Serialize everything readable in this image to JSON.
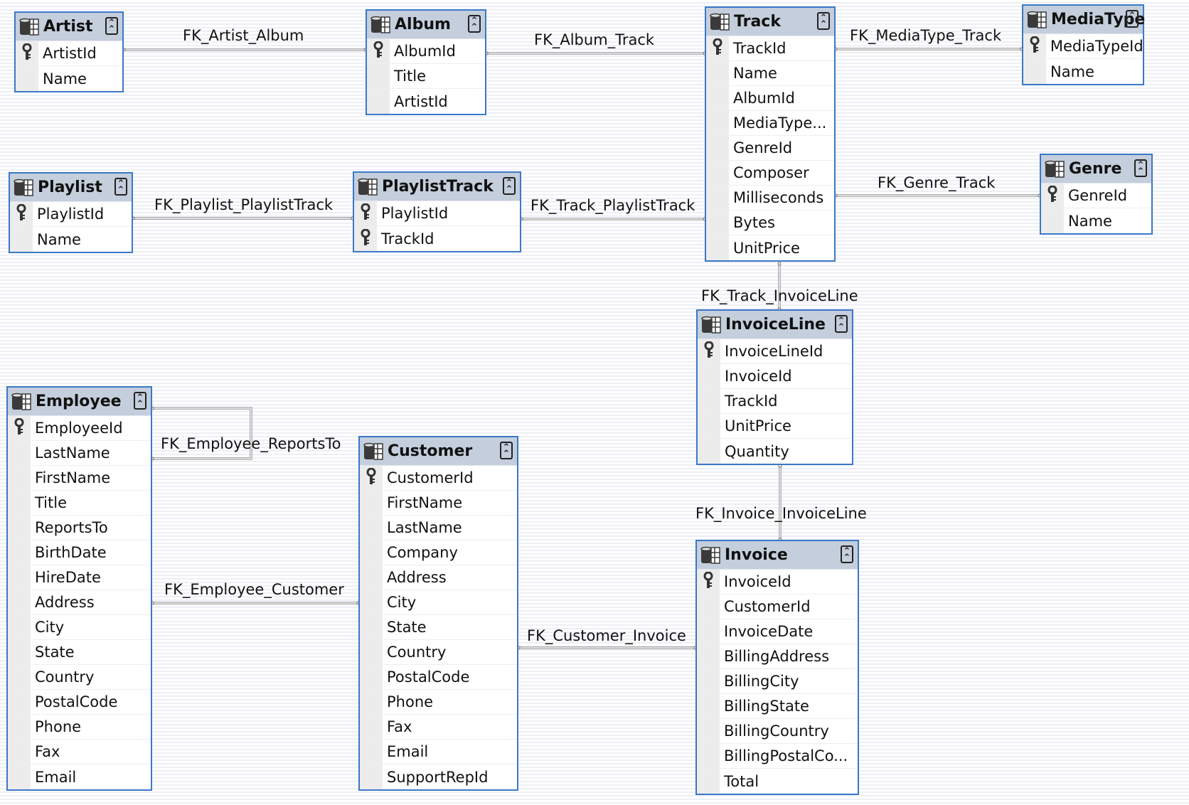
{
  "tables": {
    "artist": {
      "name": "Artist",
      "columns": [
        {
          "name": "ArtistId",
          "pk": true
        },
        {
          "name": "Name",
          "pk": false
        }
      ]
    },
    "album": {
      "name": "Album",
      "columns": [
        {
          "name": "AlbumId",
          "pk": true
        },
        {
          "name": "Title",
          "pk": false
        },
        {
          "name": "ArtistId",
          "pk": false
        }
      ]
    },
    "track": {
      "name": "Track",
      "columns": [
        {
          "name": "TrackId",
          "pk": true
        },
        {
          "name": "Name",
          "pk": false
        },
        {
          "name": "AlbumId",
          "pk": false
        },
        {
          "name": "MediaType...",
          "pk": false
        },
        {
          "name": "GenreId",
          "pk": false
        },
        {
          "name": "Composer",
          "pk": false
        },
        {
          "name": "Milliseconds",
          "pk": false
        },
        {
          "name": "Bytes",
          "pk": false
        },
        {
          "name": "UnitPrice",
          "pk": false
        }
      ]
    },
    "mediatype": {
      "name": "MediaType",
      "columns": [
        {
          "name": "MediaTypeId",
          "pk": true
        },
        {
          "name": "Name",
          "pk": false
        }
      ]
    },
    "genre": {
      "name": "Genre",
      "columns": [
        {
          "name": "GenreId",
          "pk": true
        },
        {
          "name": "Name",
          "pk": false
        }
      ]
    },
    "playlist": {
      "name": "Playlist",
      "columns": [
        {
          "name": "PlaylistId",
          "pk": true
        },
        {
          "name": "Name",
          "pk": false
        }
      ]
    },
    "playlisttrack": {
      "name": "PlaylistTrack",
      "columns": [
        {
          "name": "PlaylistId",
          "pk": true
        },
        {
          "name": "TrackId",
          "pk": true
        }
      ]
    },
    "invoiceline": {
      "name": "InvoiceLine",
      "columns": [
        {
          "name": "InvoiceLineId",
          "pk": true
        },
        {
          "name": "InvoiceId",
          "pk": false
        },
        {
          "name": "TrackId",
          "pk": false
        },
        {
          "name": "UnitPrice",
          "pk": false
        },
        {
          "name": "Quantity",
          "pk": false
        }
      ]
    },
    "employee": {
      "name": "Employee",
      "columns": [
        {
          "name": "EmployeeId",
          "pk": true
        },
        {
          "name": "LastName",
          "pk": false
        },
        {
          "name": "FirstName",
          "pk": false
        },
        {
          "name": "Title",
          "pk": false
        },
        {
          "name": "ReportsTo",
          "pk": false
        },
        {
          "name": "BirthDate",
          "pk": false
        },
        {
          "name": "HireDate",
          "pk": false
        },
        {
          "name": "Address",
          "pk": false
        },
        {
          "name": "City",
          "pk": false
        },
        {
          "name": "State",
          "pk": false
        },
        {
          "name": "Country",
          "pk": false
        },
        {
          "name": "PostalCode",
          "pk": false
        },
        {
          "name": "Phone",
          "pk": false
        },
        {
          "name": "Fax",
          "pk": false
        },
        {
          "name": "Email",
          "pk": false
        }
      ]
    },
    "customer": {
      "name": "Customer",
      "columns": [
        {
          "name": "CustomerId",
          "pk": true
        },
        {
          "name": "FirstName",
          "pk": false
        },
        {
          "name": "LastName",
          "pk": false
        },
        {
          "name": "Company",
          "pk": false
        },
        {
          "name": "Address",
          "pk": false
        },
        {
          "name": "City",
          "pk": false
        },
        {
          "name": "State",
          "pk": false
        },
        {
          "name": "Country",
          "pk": false
        },
        {
          "name": "PostalCode",
          "pk": false
        },
        {
          "name": "Phone",
          "pk": false
        },
        {
          "name": "Fax",
          "pk": false
        },
        {
          "name": "Email",
          "pk": false
        },
        {
          "name": "SupportRepId",
          "pk": false
        }
      ]
    },
    "invoice": {
      "name": "Invoice",
      "columns": [
        {
          "name": "InvoiceId",
          "pk": true
        },
        {
          "name": "CustomerId",
          "pk": false
        },
        {
          "name": "InvoiceDate",
          "pk": false
        },
        {
          "name": "BillingAddress",
          "pk": false
        },
        {
          "name": "BillingCity",
          "pk": false
        },
        {
          "name": "BillingState",
          "pk": false
        },
        {
          "name": "BillingCountry",
          "pk": false
        },
        {
          "name": "BillingPostalCo...",
          "pk": false
        },
        {
          "name": "Total",
          "pk": false
        }
      ]
    }
  },
  "relationships": [
    {
      "id": "artist_album",
      "label": "FK_Artist_Album",
      "from": "Album",
      "to": "Artist"
    },
    {
      "id": "album_track",
      "label": "FK_Album_Track",
      "from": "Track",
      "to": "Album"
    },
    {
      "id": "mediatype_track",
      "label": "FK_MediaType_Track",
      "from": "Track",
      "to": "MediaType"
    },
    {
      "id": "genre_track",
      "label": "FK_Genre_Track",
      "from": "Track",
      "to": "Genre"
    },
    {
      "id": "playlist_playlisttrack",
      "label": "FK_Playlist_PlaylistTrack",
      "from": "PlaylistTrack",
      "to": "Playlist"
    },
    {
      "id": "track_playlisttrack",
      "label": "FK_Track_PlaylistTrack",
      "from": "PlaylistTrack",
      "to": "Track"
    },
    {
      "id": "track_invoiceline",
      "label": "FK_Track_InvoiceLine",
      "from": "InvoiceLine",
      "to": "Track"
    },
    {
      "id": "invoice_invoiceline",
      "label": "FK_Invoice_InvoiceLine",
      "from": "InvoiceLine",
      "to": "Invoice"
    },
    {
      "id": "employee_reportsto",
      "label": "FK_Employee_ReportsTo",
      "from": "Employee",
      "to": "Employee"
    },
    {
      "id": "employee_customer",
      "label": "FK_Employee_Customer",
      "from": "Customer",
      "to": "Employee"
    },
    {
      "id": "customer_invoice",
      "label": "FK_Customer_Invoice",
      "from": "Invoice",
      "to": "Customer"
    }
  ],
  "colors": {
    "table_border": "#3a78c8",
    "header_bg": "#c4cedc",
    "link": "#7a7a7a"
  }
}
